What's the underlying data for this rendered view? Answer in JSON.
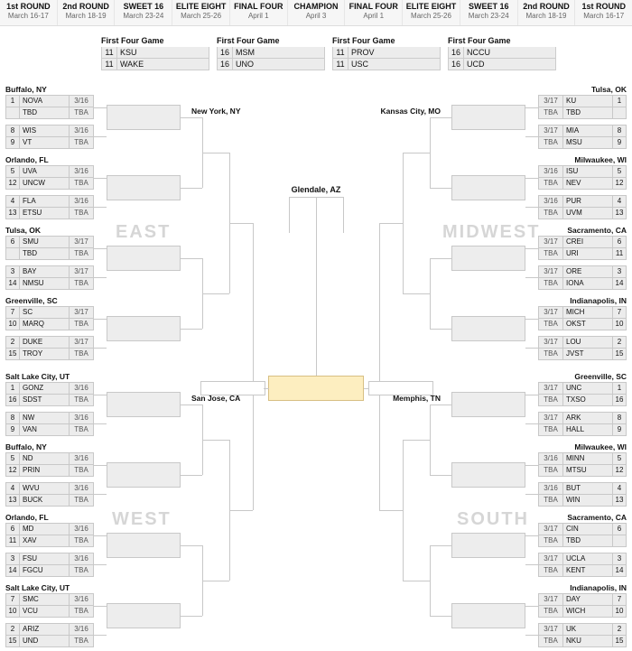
{
  "header": [
    {
      "a": "1st ROUND",
      "b": "March 16-17"
    },
    {
      "a": "2nd ROUND",
      "b": "March 18-19"
    },
    {
      "a": "SWEET 16",
      "b": "March 23-24"
    },
    {
      "a": "ELITE EIGHT",
      "b": "March 25-26"
    },
    {
      "a": "FINAL FOUR",
      "b": "April 1"
    },
    {
      "a": "CHAMPION",
      "b": "April 3"
    },
    {
      "a": "FINAL FOUR",
      "b": "April 1"
    },
    {
      "a": "ELITE EIGHT",
      "b": "March 25-26"
    },
    {
      "a": "SWEET 16",
      "b": "March 23-24"
    },
    {
      "a": "2nd ROUND",
      "b": "March 18-19"
    },
    {
      "a": "1st ROUND",
      "b": "March 16-17"
    }
  ],
  "first_four": {
    "title": "First Four Game",
    "games": [
      [
        {
          "s": "11",
          "n": "KSU"
        },
        {
          "s": "11",
          "n": "WAKE"
        }
      ],
      [
        {
          "s": "16",
          "n": "MSM"
        },
        {
          "s": "16",
          "n": "UNO"
        }
      ],
      [
        {
          "s": "11",
          "n": "PROV"
        },
        {
          "s": "11",
          "n": "USC"
        }
      ],
      [
        {
          "s": "16",
          "n": "NCCU"
        },
        {
          "s": "16",
          "n": "UCD"
        }
      ]
    ]
  },
  "final_site": "Glendale, AZ",
  "regions": {
    "EAST": {
      "label": "EAST",
      "r2": "New York, NY",
      "pods": [
        {
          "loc": "Buffalo, NY",
          "g": [
            [
              {
                "s": "1",
                "n": "NOVA",
                "d": "3/16"
              },
              {
                "s": "",
                "n": "TBD",
                "d": "TBA"
              }
            ],
            [
              {
                "s": "8",
                "n": "WIS",
                "d": "3/16"
              },
              {
                "s": "9",
                "n": "VT",
                "d": "TBA"
              }
            ]
          ]
        },
        {
          "loc": "Orlando, FL",
          "g": [
            [
              {
                "s": "5",
                "n": "UVA",
                "d": "3/16"
              },
              {
                "s": "12",
                "n": "UNCW",
                "d": "TBA"
              }
            ],
            [
              {
                "s": "4",
                "n": "FLA",
                "d": "3/16"
              },
              {
                "s": "13",
                "n": "ETSU",
                "d": "TBA"
              }
            ]
          ]
        },
        {
          "loc": "Tulsa, OK",
          "g": [
            [
              {
                "s": "6",
                "n": "SMU",
                "d": "3/17"
              },
              {
                "s": "",
                "n": "TBD",
                "d": "TBA"
              }
            ],
            [
              {
                "s": "3",
                "n": "BAY",
                "d": "3/17"
              },
              {
                "s": "14",
                "n": "NMSU",
                "d": "TBA"
              }
            ]
          ]
        },
        {
          "loc": "Greenville, SC",
          "g": [
            [
              {
                "s": "7",
                "n": "SC",
                "d": "3/17"
              },
              {
                "s": "10",
                "n": "MARQ",
                "d": "TBA"
              }
            ],
            [
              {
                "s": "2",
                "n": "DUKE",
                "d": "3/17"
              },
              {
                "s": "15",
                "n": "TROY",
                "d": "TBA"
              }
            ]
          ]
        }
      ]
    },
    "WEST": {
      "label": "WEST",
      "r2": "San Jose, CA",
      "pods": [
        {
          "loc": "Salt Lake City, UT",
          "g": [
            [
              {
                "s": "1",
                "n": "GONZ",
                "d": "3/16"
              },
              {
                "s": "16",
                "n": "SDST",
                "d": "TBA"
              }
            ],
            [
              {
                "s": "8",
                "n": "NW",
                "d": "3/16"
              },
              {
                "s": "9",
                "n": "VAN",
                "d": "TBA"
              }
            ]
          ]
        },
        {
          "loc": "Buffalo, NY",
          "g": [
            [
              {
                "s": "5",
                "n": "ND",
                "d": "3/16"
              },
              {
                "s": "12",
                "n": "PRIN",
                "d": "TBA"
              }
            ],
            [
              {
                "s": "4",
                "n": "WVU",
                "d": "3/16"
              },
              {
                "s": "13",
                "n": "BUCK",
                "d": "TBA"
              }
            ]
          ]
        },
        {
          "loc": "Orlando, FL",
          "g": [
            [
              {
                "s": "6",
                "n": "MD",
                "d": "3/16"
              },
              {
                "s": "11",
                "n": "XAV",
                "d": "TBA"
              }
            ],
            [
              {
                "s": "3",
                "n": "FSU",
                "d": "3/16"
              },
              {
                "s": "14",
                "n": "FGCU",
                "d": "TBA"
              }
            ]
          ]
        },
        {
          "loc": "Salt Lake City, UT",
          "g": [
            [
              {
                "s": "7",
                "n": "SMC",
                "d": "3/16"
              },
              {
                "s": "10",
                "n": "VCU",
                "d": "TBA"
              }
            ],
            [
              {
                "s": "2",
                "n": "ARIZ",
                "d": "3/16"
              },
              {
                "s": "15",
                "n": "UND",
                "d": "TBA"
              }
            ]
          ]
        }
      ]
    },
    "MIDWEST": {
      "label": "MIDWEST",
      "r2": "Kansas City, MO",
      "pods": [
        {
          "loc": "Tulsa, OK",
          "g": [
            [
              {
                "s": "1",
                "n": "KU",
                "d": "3/17"
              },
              {
                "s": "",
                "n": "TBD",
                "d": "TBA"
              }
            ],
            [
              {
                "s": "8",
                "n": "MIA",
                "d": "3/17"
              },
              {
                "s": "9",
                "n": "MSU",
                "d": "TBA"
              }
            ]
          ]
        },
        {
          "loc": "Milwaukee, WI",
          "g": [
            [
              {
                "s": "5",
                "n": "ISU",
                "d": "3/16"
              },
              {
                "s": "12",
                "n": "NEV",
                "d": "TBA"
              }
            ],
            [
              {
                "s": "4",
                "n": "PUR",
                "d": "3/16"
              },
              {
                "s": "13",
                "n": "UVM",
                "d": "TBA"
              }
            ]
          ]
        },
        {
          "loc": "Sacramento, CA",
          "g": [
            [
              {
                "s": "6",
                "n": "CREI",
                "d": "3/17"
              },
              {
                "s": "11",
                "n": "URI",
                "d": "TBA"
              }
            ],
            [
              {
                "s": "3",
                "n": "ORE",
                "d": "3/17"
              },
              {
                "s": "14",
                "n": "IONA",
                "d": "TBA"
              }
            ]
          ]
        },
        {
          "loc": "Indianapolis, IN",
          "g": [
            [
              {
                "s": "7",
                "n": "MICH",
                "d": "3/17"
              },
              {
                "s": "10",
                "n": "OKST",
                "d": "TBA"
              }
            ],
            [
              {
                "s": "2",
                "n": "LOU",
                "d": "3/17"
              },
              {
                "s": "15",
                "n": "JVST",
                "d": "TBA"
              }
            ]
          ]
        }
      ]
    },
    "SOUTH": {
      "label": "SOUTH",
      "r2": "Memphis, TN",
      "pods": [
        {
          "loc": "Greenville, SC",
          "g": [
            [
              {
                "s": "1",
                "n": "UNC",
                "d": "3/17"
              },
              {
                "s": "16",
                "n": "TXSO",
                "d": "TBA"
              }
            ],
            [
              {
                "s": "8",
                "n": "ARK",
                "d": "3/17"
              },
              {
                "s": "9",
                "n": "HALL",
                "d": "TBA"
              }
            ]
          ]
        },
        {
          "loc": "Milwaukee, WI",
          "g": [
            [
              {
                "s": "5",
                "n": "MINN",
                "d": "3/16"
              },
              {
                "s": "12",
                "n": "MTSU",
                "d": "TBA"
              }
            ],
            [
              {
                "s": "4",
                "n": "BUT",
                "d": "3/16"
              },
              {
                "s": "13",
                "n": "WIN",
                "d": "TBA"
              }
            ]
          ]
        },
        {
          "loc": "Sacramento, CA",
          "g": [
            [
              {
                "s": "6",
                "n": "CIN",
                "d": "3/17"
              },
              {
                "s": "",
                "n": "TBD",
                "d": "TBA"
              }
            ],
            [
              {
                "s": "3",
                "n": "UCLA",
                "d": "3/17"
              },
              {
                "s": "14",
                "n": "KENT",
                "d": "TBA"
              }
            ]
          ]
        },
        {
          "loc": "Indianapolis, IN",
          "g": [
            [
              {
                "s": "7",
                "n": "DAY",
                "d": "3/17"
              },
              {
                "s": "10",
                "n": "WICH",
                "d": "TBA"
              }
            ],
            [
              {
                "s": "2",
                "n": "UK",
                "d": "3/17"
              },
              {
                "s": "15",
                "n": "NKU",
                "d": "TBA"
              }
            ]
          ]
        }
      ]
    }
  }
}
